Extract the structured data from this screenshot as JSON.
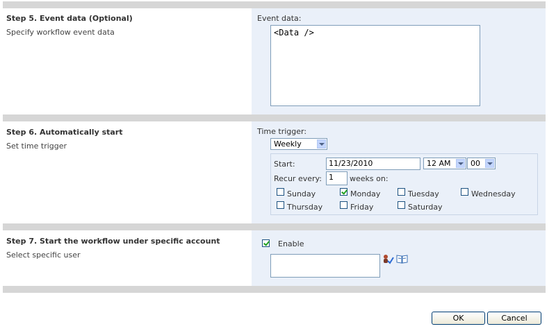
{
  "step5": {
    "title": "Step 5. Event data (Optional)",
    "description": "Specify workflow event data",
    "field_label": "Event data:",
    "event_data_value": "<Data />"
  },
  "step6": {
    "title": "Step 6. Automatically start",
    "description": "Set time trigger",
    "time_trigger_label": "Time trigger:",
    "time_trigger_value": "Weekly",
    "start_label": "Start:",
    "start_date": "11/23/2010",
    "hour_value": "12 AM",
    "minute_value": "00",
    "recur_label": "Recur every:",
    "recur_value": "1",
    "weeks_on_label": "weeks on:",
    "days": [
      {
        "label": "Sunday",
        "checked": false
      },
      {
        "label": "Monday",
        "checked": true
      },
      {
        "label": "Tuesday",
        "checked": false
      },
      {
        "label": "Wednesday",
        "checked": false
      },
      {
        "label": "Thursday",
        "checked": false
      },
      {
        "label": "Friday",
        "checked": false
      },
      {
        "label": "Saturday",
        "checked": false
      }
    ]
  },
  "step7": {
    "title": "Step 7. Start the workflow under specific account",
    "description": "Select specific user",
    "enable_label": "Enable",
    "enable_checked": true,
    "user_value": "",
    "check_names_icon": "check-names-icon",
    "browse_icon": "address-book-icon"
  },
  "buttons": {
    "ok_label": "OK",
    "cancel_label": "Cancel"
  }
}
